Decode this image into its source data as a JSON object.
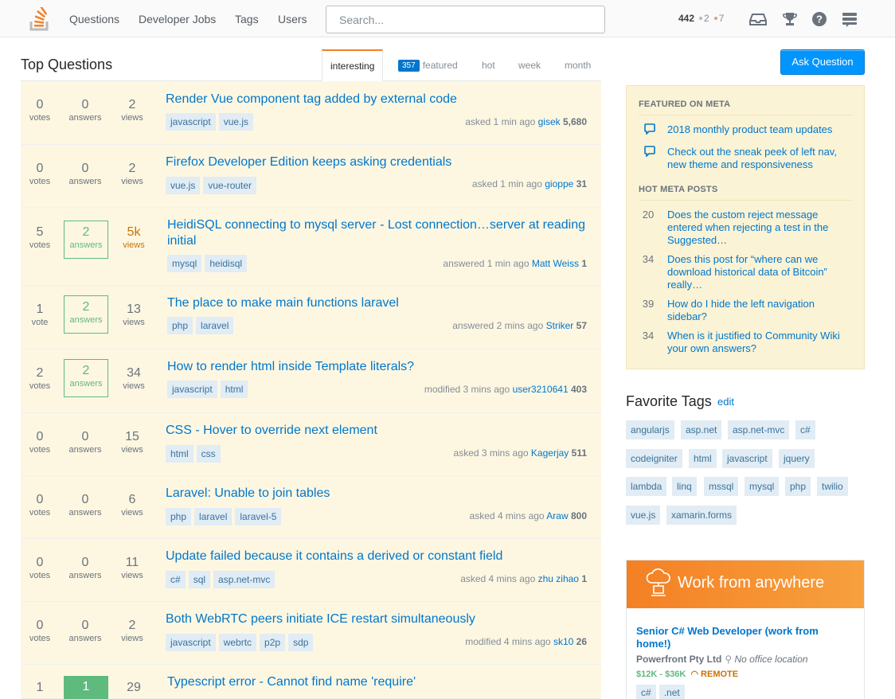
{
  "topbar": {
    "nav": [
      "Questions",
      "Developer Jobs",
      "Tags",
      "Users"
    ],
    "search_placeholder": "Search...",
    "reputation": "442",
    "silver_badges": "2",
    "bronze_badges": "7",
    "colors": {
      "silver": "#b4b8bc",
      "bronze": "#d1a684",
      "accent": "#f48024"
    }
  },
  "main": {
    "title": "Top Questions",
    "tabs": {
      "interesting": "interesting",
      "featured_count": "357",
      "featured": "featured",
      "hot": "hot",
      "week": "week",
      "month": "month"
    },
    "questions": [
      {
        "votes": "0",
        "votes_label": "votes",
        "answers": "0",
        "answers_label": "answers",
        "views": "2",
        "views_label": "views",
        "title": "Render Vue component tag added by external code",
        "tags": [
          "javascript",
          "vue.js"
        ],
        "action": "asked 1 min ago",
        "user": "gisek",
        "rep": "5,680"
      },
      {
        "votes": "0",
        "votes_label": "votes",
        "answers": "0",
        "answers_label": "answers",
        "views": "2",
        "views_label": "views",
        "title": "Firefox Developer Edition keeps asking credentials",
        "tags": [
          "vue.js",
          "vue-router"
        ],
        "action": "asked 1 min ago",
        "user": "gioppe",
        "rep": "31"
      },
      {
        "votes": "5",
        "votes_label": "votes",
        "answers": "2",
        "answers_label": "answers",
        "views": "5k",
        "views_label": "views",
        "title": "HeidiSQL connecting to mysql server - Lost connection…server at reading initial",
        "tags": [
          "mysql",
          "heidisql"
        ],
        "action": "answered 1 min ago",
        "user": "Matt Weiss",
        "rep": "1"
      },
      {
        "votes": "1",
        "votes_label": "vote",
        "answers": "2",
        "answers_label": "answers",
        "views": "13",
        "views_label": "views",
        "title": "The place to make main functions laravel",
        "tags": [
          "php",
          "laravel"
        ],
        "action": "answered 2 mins ago",
        "user": "Striker",
        "rep": "57"
      },
      {
        "votes": "2",
        "votes_label": "votes",
        "answers": "2",
        "answers_label": "answers",
        "views": "34",
        "views_label": "views",
        "title": "How to render html inside Template literals?",
        "tags": [
          "javascript",
          "html"
        ],
        "action": "modified 3 mins ago",
        "user": "user3210641",
        "rep": "403"
      },
      {
        "votes": "0",
        "votes_label": "votes",
        "answers": "0",
        "answers_label": "answers",
        "views": "15",
        "views_label": "views",
        "title": "CSS - Hover to override next element",
        "tags": [
          "html",
          "css"
        ],
        "action": "asked 3 mins ago",
        "user": "Kagerjay",
        "rep": "511"
      },
      {
        "votes": "0",
        "votes_label": "votes",
        "answers": "0",
        "answers_label": "answers",
        "views": "6",
        "views_label": "views",
        "title": "Laravel: Unable to join tables",
        "tags": [
          "php",
          "laravel",
          "laravel-5"
        ],
        "action": "asked 4 mins ago",
        "user": "Araw",
        "rep": "800"
      },
      {
        "votes": "0",
        "votes_label": "votes",
        "answers": "0",
        "answers_label": "answers",
        "views": "11",
        "views_label": "views",
        "title": "Update failed because it contains a derived or constant field",
        "tags": [
          "c#",
          "sql",
          "asp.net-mvc"
        ],
        "action": "asked 4 mins ago",
        "user": "zhu zihao",
        "rep": "1"
      },
      {
        "votes": "0",
        "votes_label": "votes",
        "answers": "0",
        "answers_label": "answers",
        "views": "2",
        "views_label": "views",
        "title": "Both WebRTC peers initiate ICE restart simultaneously",
        "tags": [
          "javascript",
          "webrtc",
          "p2p",
          "sdp"
        ],
        "action": "modified 4 mins ago",
        "user": "sk10",
        "rep": "26"
      },
      {
        "votes": "1",
        "votes_label": "",
        "answers": "1",
        "answers_label": "",
        "views": "29",
        "views_label": "",
        "title": "Typescript error - Cannot find name 'require'",
        "tags": [],
        "action": "",
        "user": "",
        "rep": ""
      }
    ]
  },
  "sidebar": {
    "ask_button": "Ask Question",
    "featured_heading": "FEATURED ON META",
    "featured": [
      "2018 monthly product team updates",
      "Check out the sneak peek of left nav, new theme and responsiveness"
    ],
    "hot_heading": "HOT META POSTS",
    "hot": [
      {
        "score": "20",
        "title": "Does the custom reject message entered when rejecting a test in the Suggested…"
      },
      {
        "score": "34",
        "title": "Does this post for “where can we download historical data of Bitcoin” really…"
      },
      {
        "score": "39",
        "title": "How do I hide the left navigation sidebar?"
      },
      {
        "score": "34",
        "title": "When is it justified to Community Wiki your own answers?"
      }
    ],
    "favorite_tags_title": "Favorite Tags",
    "favorite_tags_edit": "edit",
    "favorite_tags": [
      "angularjs",
      "asp.net",
      "asp.net-mvc",
      "c#",
      "codeigniter",
      "html",
      "javascript",
      "jquery",
      "lambda",
      "linq",
      "mssql",
      "mysql",
      "php",
      "twilio",
      "vue.js",
      "xamarin.forms"
    ],
    "job": {
      "banner": "Work from anywhere",
      "title": "Senior C# Web Developer (work from home!)",
      "company": "Powerfront Pty Ltd",
      "location": "No office location",
      "salary": "$12K - $36K",
      "remote": "REMOTE",
      "tags": [
        "c#",
        ".net"
      ]
    }
  }
}
